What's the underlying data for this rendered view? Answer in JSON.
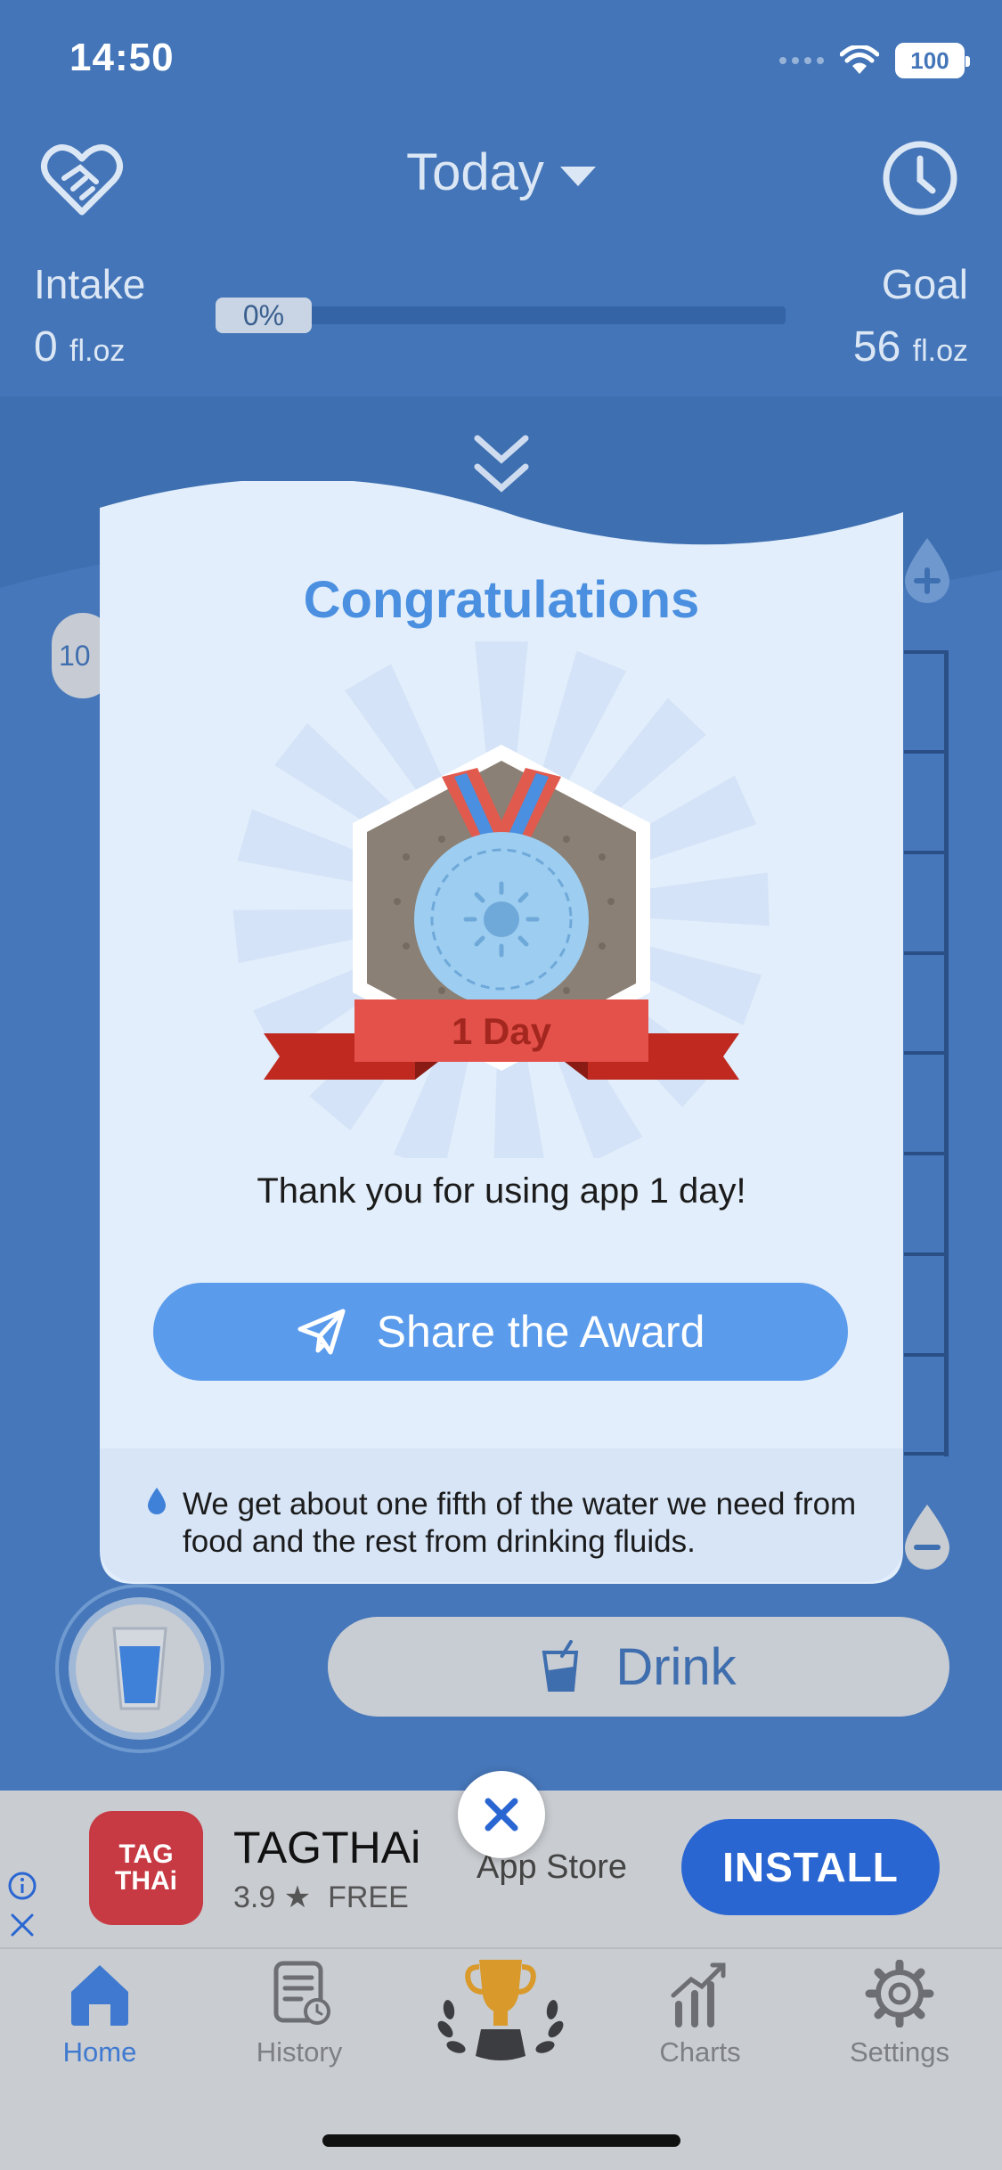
{
  "status_bar": {
    "time": "14:50",
    "battery": "100"
  },
  "header": {
    "period": "Today",
    "intake_label": "Intake",
    "intake_value": "0",
    "intake_unit": "fl.oz",
    "goal_label": "Goal",
    "goal_value": "56",
    "goal_unit": "fl.oz",
    "progress_label": "0%",
    "progress_fraction": 0
  },
  "background": {
    "bubble_text": "10",
    "drink_label": "Drink"
  },
  "modal": {
    "title": "Congratulations",
    "badge_label": "1 Day",
    "message": "Thank you for using app 1 day!",
    "share_label": "Share the Award",
    "tip": "We get about one fifth of the water we need from food and the rest from drinking fluids."
  },
  "ad": {
    "logo_line1": "TAG",
    "logo_line2": "THAi",
    "app_name": "TAGTHAi",
    "rating": "3.9",
    "price": "FREE",
    "store": "App Store",
    "install_label": "INSTALL"
  },
  "tabbar": {
    "items": [
      {
        "label": "Home",
        "active": true
      },
      {
        "label": "History",
        "active": false
      },
      {
        "label": "",
        "active": false
      },
      {
        "label": "Charts",
        "active": false
      },
      {
        "label": "Settings",
        "active": false
      }
    ]
  },
  "colors": {
    "header_blue": "#4375b8",
    "accent_blue": "#4a8fe0",
    "share_button": "#5a9bec",
    "badge_ribbon": "#e4514a",
    "install_button": "#2a66d2"
  }
}
